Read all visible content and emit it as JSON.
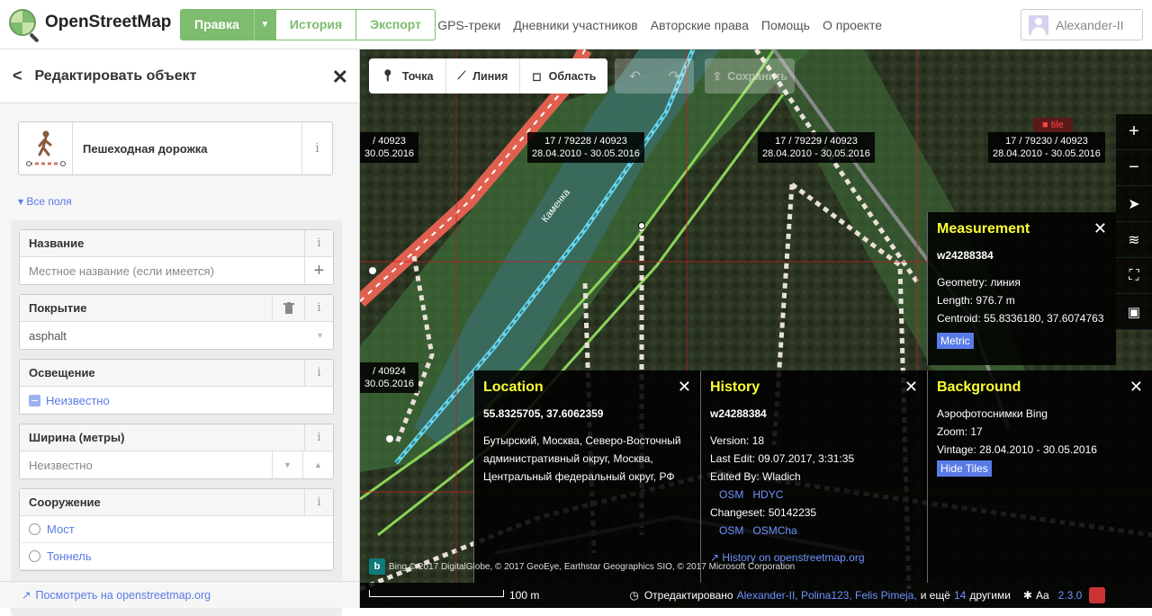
{
  "header": {
    "logo_text": "OpenStreetMap",
    "edit_label": "Правка",
    "history_label": "История",
    "export_label": "Экспорт",
    "nav": [
      "GPS-треки",
      "Дневники участников",
      "Авторские права",
      "Помощь",
      "О проекте"
    ],
    "user": "Alexander-II"
  },
  "sidebar": {
    "title": "Редактировать объект",
    "preset_name": "Пешеходная дорожка",
    "all_fields": "Все поля",
    "fields": {
      "name_label": "Название",
      "name_placeholder": "Местное название (если имеется)",
      "surface_label": "Покрытие",
      "surface_value": "asphalt",
      "lit_label": "Освещение",
      "lit_value": "Неизвестно",
      "width_label": "Ширина (метры)",
      "width_placeholder": "Неизвестно",
      "structure_label": "Сооружение",
      "structure_options": [
        "Мост",
        "Тоннель"
      ]
    },
    "footer_link": "Посмотреть на openstreetmap.org"
  },
  "toolbar": {
    "point": "Точка",
    "line": "Линия",
    "area": "Область",
    "save": "Сохранить"
  },
  "map": {
    "street_label": "Каменка",
    "tile_labels": [
      {
        "line1": "/ 40923",
        "line2": "30.05.2016"
      },
      {
        "line1": "17 / 79228 / 40923",
        "line2": "28.04.2010 - 30.05.2016"
      },
      {
        "line1": "17 / 79229 / 40923",
        "line2": "28.04.2010 - 30.05.2016"
      },
      {
        "line1": "17 / 79230 / 40923",
        "line2": "28.04.2010 - 30.05.2016"
      },
      {
        "line1": "/ 40924",
        "line2": "30.05.2016"
      }
    ],
    "tile_tag": "tile",
    "attribution": "Bing © 2017 DigitalGlobe, © 2017 GeoEye, Earthstar Geographics SIO, © 2017 Microsoft Corporation",
    "scale": "100 m",
    "edited_by_prefix": "Отредактировано",
    "editors": "Alexander-II, Polina123, Felis Pimeja,",
    "and_more": "и ещё",
    "more_count": "14",
    "others": "другими",
    "version": "2.3.0"
  },
  "measurement": {
    "title": "Measurement",
    "id": "w24288384",
    "geometry": "Geometry: линия",
    "length": "Length: 976.7 m",
    "centroid": "Centroid: 55.8336180, 37.6074763",
    "button": "Metric"
  },
  "location": {
    "title": "Location",
    "coords": "55.8325705, 37.6062359",
    "address": "Бутырский, Москва, Северо-Восточный административный округ, Москва, Центральный федеральный округ, РФ"
  },
  "history": {
    "title": "History",
    "id": "w24288384",
    "version": "Version: 18",
    "last_edit": "Last Edit: 09.07.2017, 3:31:35",
    "edited_by": "Edited By: Wladich",
    "links1": [
      "OSM",
      "HDYC"
    ],
    "changeset": "Changeset: 50142235",
    "links2": [
      "OSM",
      "OSMCha"
    ],
    "history_link": "History on openstreetmap.org"
  },
  "background": {
    "title": "Background",
    "source": "Аэрофотоснимки Bing",
    "zoom": "Zoom: 17",
    "vintage": "Vintage: 28.04.2010 - 30.05.2016",
    "button": "Hide Tiles"
  }
}
